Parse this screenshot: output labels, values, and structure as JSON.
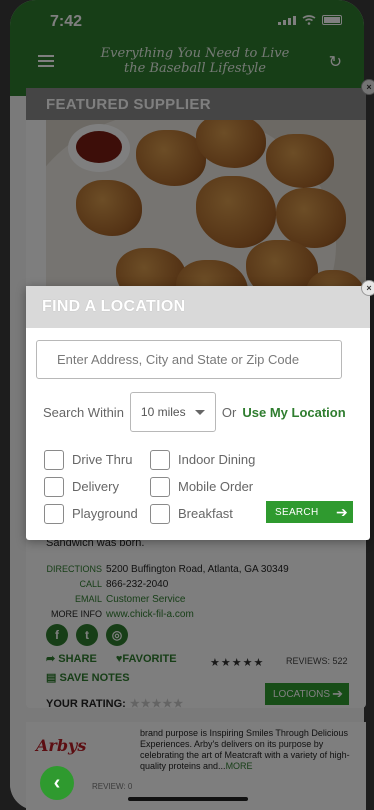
{
  "status_bar": {
    "time": "7:42"
  },
  "header": {
    "tagline_line1": "Everything You Need to Live",
    "tagline_line2": "the Baseball Lifestyle"
  },
  "featured": {
    "title": "FEATURED SUPPLIER",
    "teaser": "Sandwich was born.",
    "directions_key": "DIRECTIONS",
    "directions_val": "5200 Buffington Road, Atlanta, GA 30349",
    "call_key": "CALL",
    "call_val": "866-232-2040",
    "email_key": "EMAIL",
    "email_val": "Customer Service",
    "moreinfo_key": "MORE INFO",
    "moreinfo_val": "www.chick-fil-a.com",
    "share_label": "SHARE",
    "favorite_label": "FAVORITE",
    "save_notes_label": "SAVE NOTES",
    "rating_stars": "★★★★★",
    "reviews_label": "REVIEWS: 522",
    "your_rating_label": "YOUR RATING:",
    "your_rating_stars": "★★★★★",
    "locations_label": "LOCATIONS"
  },
  "next_listing": {
    "logo_text": "Arbys",
    "desc": "brand purpose is Inspiring Smiles Through Delicious Experiences. Arby's delivers on its purpose by celebrating the art of Meatcraft with a variety of high-quality proteins and...",
    "more_label": "MORE",
    "review_label": "REVIEW: 0"
  },
  "modal": {
    "title": "FIND A LOCATION",
    "address_placeholder": "Enter Address, City and State or Zip Code",
    "search_within_label": "Search Within",
    "distance_value": "10 miles",
    "or_label": "Or",
    "use_location_label": "Use My Location",
    "options": [
      "Drive Thru",
      "Indoor Dining",
      "Delivery",
      "Mobile Order",
      "Playground",
      "Breakfast"
    ],
    "search_label": "SEARCH"
  },
  "colors": {
    "brand_green": "#2f7d2f",
    "button_green": "#2f9a2f",
    "arbys_red": "#b81d24"
  },
  "icons": {
    "menu": "hamburger-icon",
    "refresh": "refresh-icon",
    "close": "close-icon",
    "arrow": "arrow-right-icon",
    "back": "chevron-left-icon"
  }
}
